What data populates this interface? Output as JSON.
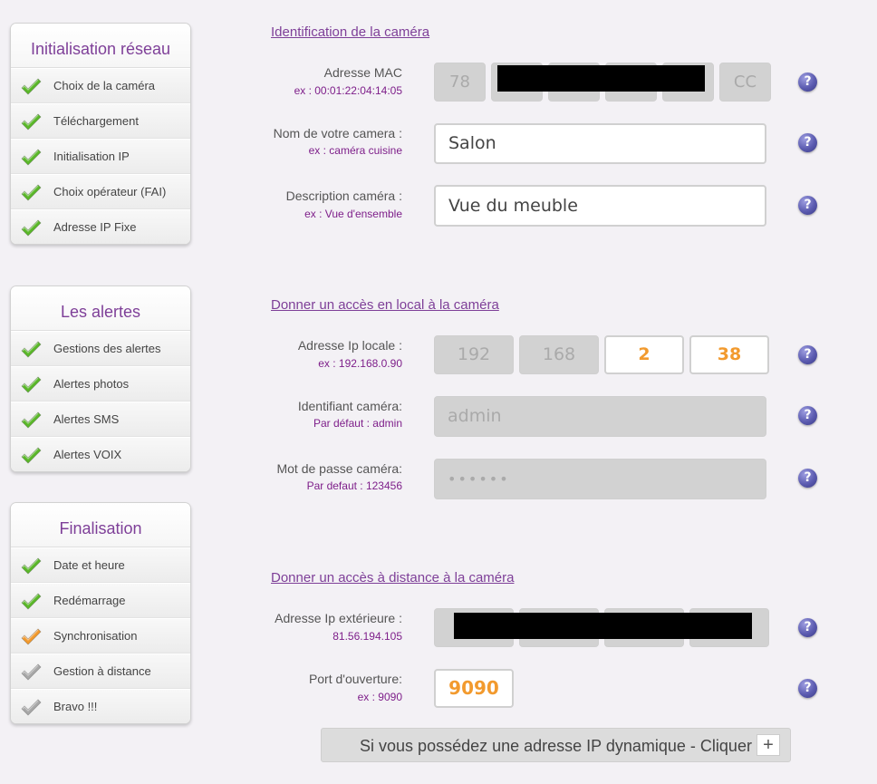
{
  "sidebar": {
    "sections": [
      {
        "title": "Initialisation réseau",
        "items": [
          {
            "label": "Choix de la caméra",
            "status": "done"
          },
          {
            "label": "Téléchargement",
            "status": "done"
          },
          {
            "label": "Initialisation IP",
            "status": "done"
          },
          {
            "label": "Choix opérateur (FAI)",
            "status": "done"
          },
          {
            "label": "Adresse IP Fixe",
            "status": "done"
          }
        ]
      },
      {
        "title": "Les alertes",
        "items": [
          {
            "label": "Gestions des alertes",
            "status": "done"
          },
          {
            "label": "Alertes photos",
            "status": "done"
          },
          {
            "label": "Alertes SMS",
            "status": "done"
          },
          {
            "label": "Alertes VOIX",
            "status": "done"
          }
        ]
      },
      {
        "title": "Finalisation",
        "items": [
          {
            "label": "Date et heure",
            "status": "done"
          },
          {
            "label": "Redémarrage",
            "status": "done"
          },
          {
            "label": "Synchronisation",
            "status": "current"
          },
          {
            "label": "Gestion à distance",
            "status": "pending"
          },
          {
            "label": "Bravo !!!",
            "status": "pending"
          }
        ]
      }
    ]
  },
  "colors": {
    "accent": "#7e3f98",
    "done": "#5bb82a",
    "current": "#f29a2e",
    "pending": "#a8a8a8",
    "help": "#5b5bb0"
  },
  "form": {
    "identification": {
      "title": "Identification de la caméra",
      "mac": {
        "label": "Adresse MAC",
        "hint": "ex : 00:01:22:04:14:05",
        "first": "78",
        "last": "CC"
      },
      "name": {
        "label": "Nom de votre camera :",
        "hint": "ex : caméra cuisine",
        "value": "Salon"
      },
      "description": {
        "label": "Description caméra :",
        "hint": "ex : Vue d'ensemble",
        "value": "Vue du meuble"
      }
    },
    "local": {
      "title": "Donner un accès en local à la caméra",
      "ip": {
        "label": "Adresse Ip locale :",
        "hint": "ex : 192.168.0.90",
        "octets": [
          "192",
          "168",
          "2",
          "38"
        ]
      },
      "user": {
        "label": "Identifiant caméra:",
        "hint": "Par défaut : admin",
        "value": "admin"
      },
      "password": {
        "label": "Mot de passe caméra:",
        "hint": "Par defaut : 123456",
        "value": "••••••"
      }
    },
    "remote": {
      "title": "Donner un accès à distance à la caméra",
      "ip": {
        "label": "Adresse Ip extérieure :",
        "hint": "81.56.194.105"
      },
      "port": {
        "label": "Port d'ouverture:",
        "hint": "ex : 9090",
        "value": "9090"
      }
    },
    "help_icon": "?",
    "dynamic_button": {
      "label": "Si vous possédez une adresse IP dynamique - Cliquer",
      "icon": "+"
    }
  }
}
